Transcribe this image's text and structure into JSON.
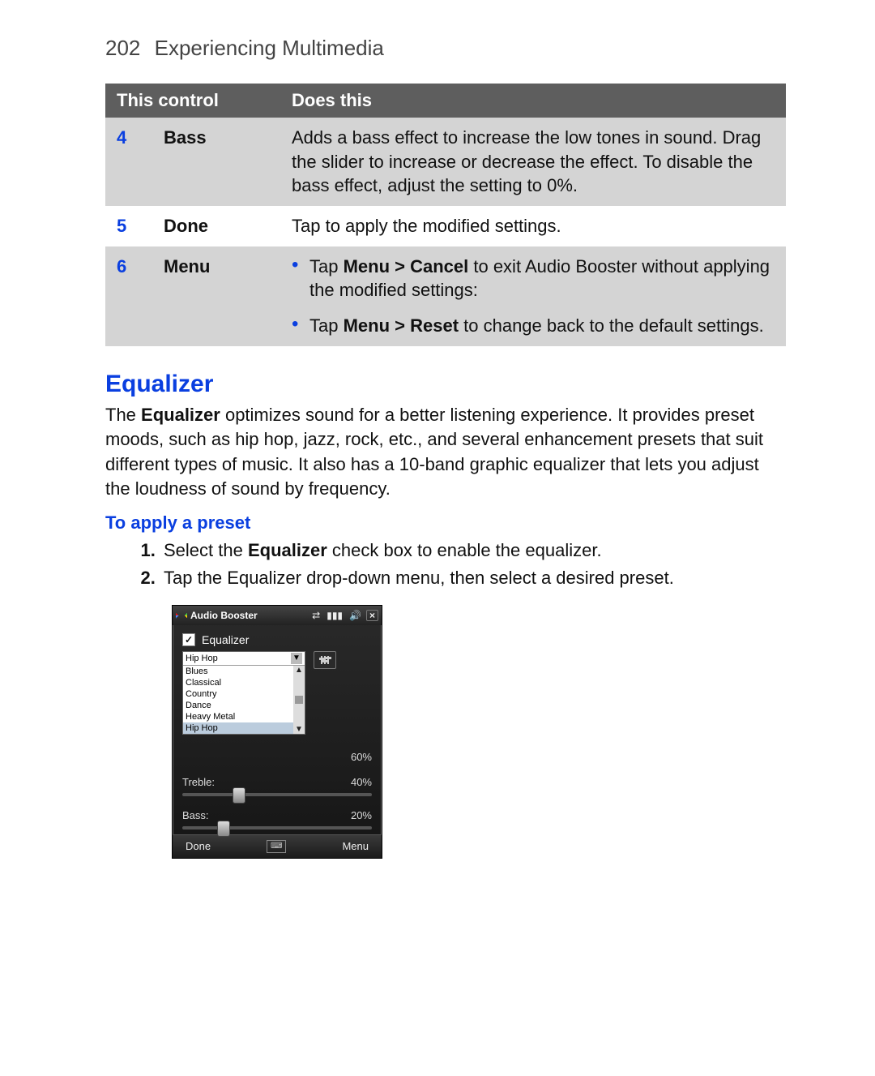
{
  "header": {
    "page_number": "202",
    "section": "Experiencing Multimedia"
  },
  "table": {
    "headers": {
      "control": "This control",
      "does": "Does this"
    },
    "rows": [
      {
        "index": "4",
        "name": "Bass",
        "desc": "Adds a bass effect to increase the low tones in sound. Drag the slider to increase or decrease the effect. To disable the bass effect, adjust the setting to 0%."
      },
      {
        "index": "5",
        "name": "Done",
        "desc": "Tap to apply the modified settings."
      },
      {
        "index": "6",
        "name": "Menu",
        "bullets": [
          {
            "pre": "Tap ",
            "bold": "Menu > Cancel",
            "post": " to exit Audio Booster without applying the modified settings:"
          },
          {
            "pre": "Tap ",
            "bold": "Menu > Reset",
            "post": " to change back to the default settings."
          }
        ]
      }
    ]
  },
  "equalizer": {
    "heading": "Equalizer",
    "para": {
      "pre": "The ",
      "bold": "Equalizer",
      "post": " optimizes sound for a better listening experience. It provides preset moods, such as hip hop, jazz, rock, etc., and several enhancement presets that suit different types of music. It also has a 10-band graphic equalizer that lets you adjust the loudness of sound by frequency."
    },
    "sub_heading": "To apply a preset",
    "steps": [
      {
        "pre": "Select the ",
        "bold": "Equalizer",
        "post": " check box to enable the equalizer."
      },
      {
        "plain": "Tap the Equalizer drop-down menu, then select a desired preset."
      }
    ]
  },
  "device": {
    "title": "Audio Booster",
    "eq_check_label": "Equalizer",
    "eq_checked": true,
    "preset_selected": "Hip Hop",
    "preset_options": [
      "Blues",
      "Classical",
      "Country",
      "Dance",
      "Heavy Metal",
      "Hip Hop"
    ],
    "sliders": {
      "first_pct": "60%",
      "treble": {
        "label": "Treble:",
        "pct": "40%",
        "pos": 30
      },
      "bass": {
        "label": "Bass:",
        "pct": "20%",
        "pos": 22
      }
    },
    "footer": {
      "left": "Done",
      "right": "Menu"
    },
    "status_icons": [
      "connect",
      "signal",
      "volume",
      "close"
    ]
  }
}
